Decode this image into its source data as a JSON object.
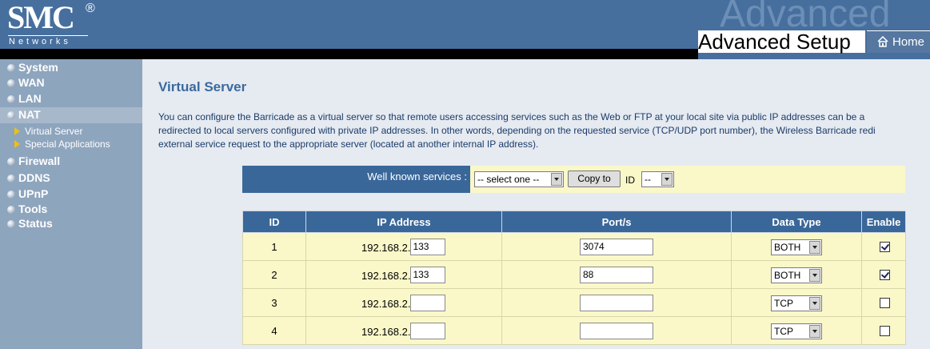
{
  "brand": {
    "logo": "SMC",
    "registered": "®",
    "sub": "Networks"
  },
  "header": {
    "watermark": "Advanced",
    "title": "Advanced Setup",
    "home_label": "Home"
  },
  "sidebar": {
    "items": [
      {
        "label": "System"
      },
      {
        "label": "WAN"
      },
      {
        "label": "LAN"
      },
      {
        "label": "NAT"
      },
      {
        "label": "Firewall"
      },
      {
        "label": "DDNS"
      },
      {
        "label": "UPnP"
      },
      {
        "label": "Tools"
      },
      {
        "label": "Status"
      }
    ],
    "sub_items": [
      {
        "label": "Virtual Server"
      },
      {
        "label": "Special Applications"
      }
    ]
  },
  "page": {
    "title": "Virtual Server",
    "desc_lines": [
      "You can configure the Barricade as a virtual server so that remote users accessing services such as the Web or FTP at your local site via public IP addresses can be a",
      "redirected to local servers configured with private IP addresses. In other words, depending on the requested service (TCP/UDP port number), the Wireless Barricade redi",
      "external service request to the appropriate server (located at another internal IP address)."
    ]
  },
  "well_known": {
    "label": "Well known services :",
    "select_value": "-- select one --",
    "copy_button": "Copy to",
    "id_label": "ID",
    "id_value": "--"
  },
  "table": {
    "headers": [
      "ID",
      "IP Address",
      "Port/s",
      "Data Type",
      "Enable"
    ],
    "ip_prefix": "192.168.2.",
    "rows": [
      {
        "id": "1",
        "ip": "133",
        "port": "3074",
        "type": "BOTH",
        "enabled": true
      },
      {
        "id": "2",
        "ip": "133",
        "port": "88",
        "type": "BOTH",
        "enabled": true
      },
      {
        "id": "3",
        "ip": "",
        "port": "",
        "type": "TCP",
        "enabled": false
      },
      {
        "id": "4",
        "ip": "",
        "port": "",
        "type": "TCP",
        "enabled": false
      }
    ]
  },
  "colors": {
    "header": "#476f9e",
    "sidebar": "#8ea5be",
    "table_header": "#3a6799",
    "cell": "#faf8c8",
    "title": "#3a6a9e"
  },
  "icons": {
    "home": "home-icon",
    "nav_bullet": "bullet-icon",
    "sub_arrow": "triangle-right-icon",
    "dropdown": "chevron-down-icon"
  }
}
